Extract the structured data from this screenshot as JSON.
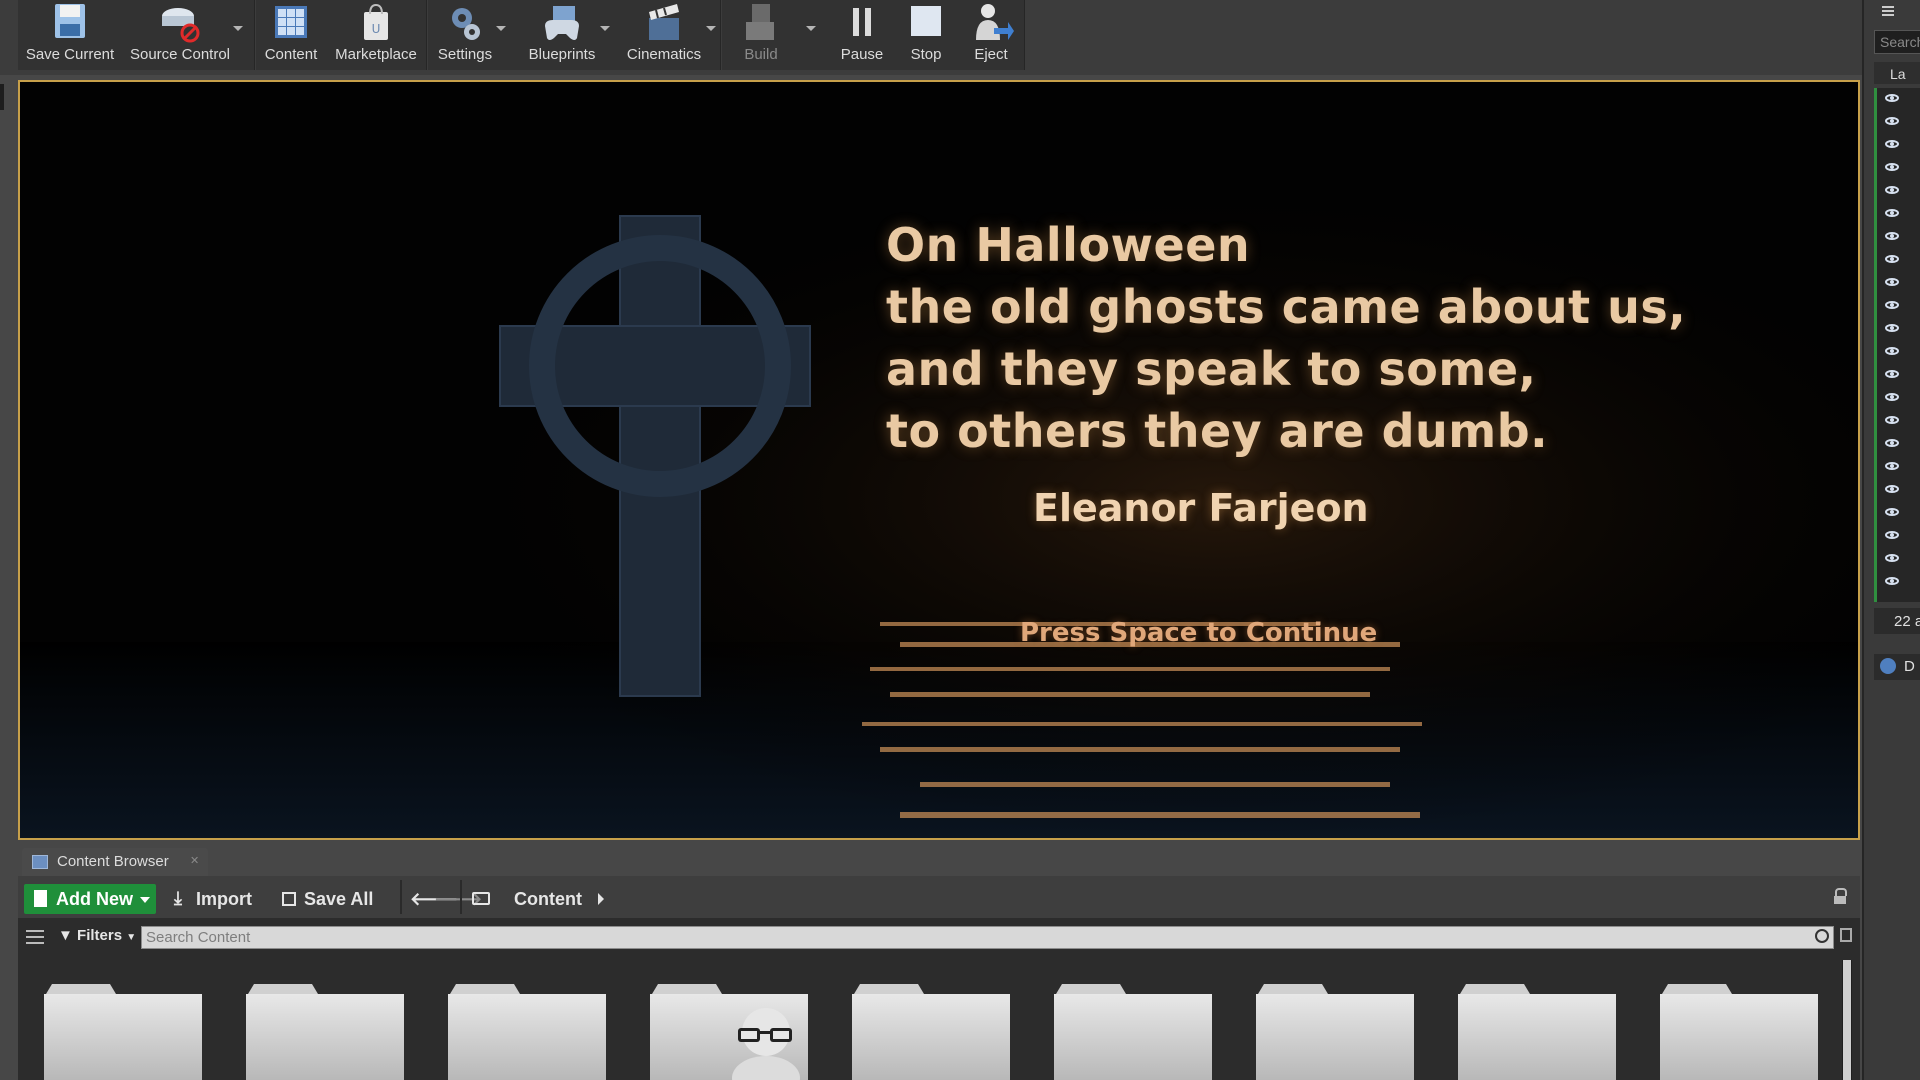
{
  "toolbar": {
    "buttons": [
      {
        "label": "Save Current"
      },
      {
        "label": "Source Control"
      },
      {
        "label": "Content"
      },
      {
        "label": "Marketplace"
      },
      {
        "label": "Settings"
      },
      {
        "label": "Blueprints"
      },
      {
        "label": "Cinematics"
      },
      {
        "label": "Build"
      },
      {
        "label": "Pause"
      },
      {
        "label": "Stop"
      },
      {
        "label": "Eject"
      }
    ]
  },
  "viewport": {
    "quote_lines": [
      "On Halloween",
      "the old ghosts came about us,",
      "and they speak to some,",
      "to others they are dumb."
    ],
    "author": "Eleanor Farjeon",
    "prompt": "Press Space to Continue"
  },
  "right_panel": {
    "search_placeholder": "Search",
    "column_header": "La",
    "count_text": "22 a",
    "details_tab": "D"
  },
  "content_browser": {
    "tab_label": "Content Browser",
    "add_new_label": "Add New",
    "import_label": "Import",
    "save_all_label": "Save All",
    "path_label": "Content",
    "filters_label": "Filters",
    "search_placeholder": "Search Content",
    "folder_count": 9
  },
  "colors": {
    "accent_green": "#1f8f3a",
    "viewport_border": "#c7a04a",
    "quote_text": "#e9c9a3"
  }
}
